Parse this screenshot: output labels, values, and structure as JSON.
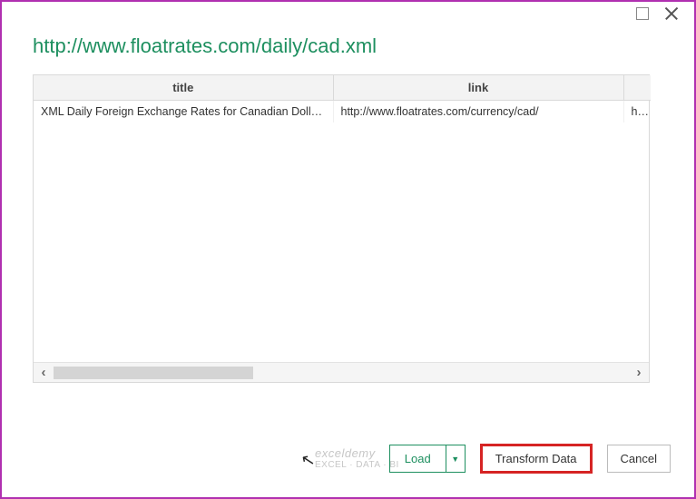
{
  "window": {
    "title": "http://www.floatrates.com/daily/cad.xml",
    "controls": {
      "maximize": "maximize",
      "close": "close"
    }
  },
  "table": {
    "columns": [
      "title",
      "link",
      ""
    ],
    "rows": [
      {
        "title": "XML Daily Foreign Exchange Rates for Canadian Dollar (…",
        "link": "http://www.floatrates.com/currency/cad/",
        "extra": "http:/"
      }
    ]
  },
  "buttons": {
    "load": "Load",
    "transform": "Transform Data",
    "cancel": "Cancel"
  },
  "watermark": {
    "line1": "exceldemy",
    "line2": "EXCEL · DATA · BI"
  },
  "icons": {
    "caret_down": "▼",
    "scroll_left": "‹",
    "scroll_right": "›",
    "cursor": "↖"
  }
}
